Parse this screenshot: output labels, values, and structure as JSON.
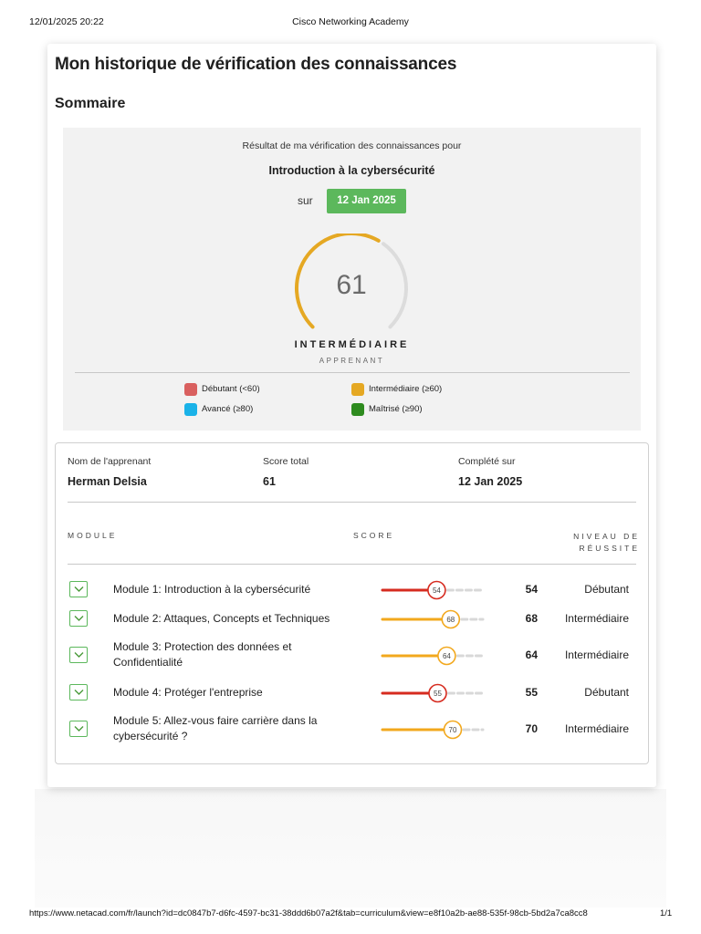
{
  "print_header": {
    "datetime": "12/01/2025 20:22",
    "title": "Cisco Networking Academy"
  },
  "page": {
    "title": "Mon historique de vérification des connaissances",
    "summary_heading": "Sommaire"
  },
  "summary": {
    "intro": "Résultat de ma vérification des connaissances pour",
    "course": "Introduction à la cybersécurité",
    "on_label": "sur",
    "date": "12 Jan 2025",
    "score": "61",
    "score_value": 61,
    "level": "INTERMÉDIAIRE",
    "level_sub": "APPRENANT",
    "legend": [
      {
        "label": "Débutant (<60)",
        "color": "#d9605f"
      },
      {
        "label": "Intermédiaire (≥60)",
        "color": "#e5a823"
      },
      {
        "label": "Avancé (≥80)",
        "color": "#1ab2e8"
      },
      {
        "label": "Maîtrisé (≥90)",
        "color": "#2e8b1f"
      }
    ]
  },
  "learner": {
    "name_label": "Nom de l'apprenant",
    "name": "Herman Delsia",
    "score_label": "Score total",
    "score": "61",
    "completed_label": "Complété sur",
    "completed": "12 Jan 2025"
  },
  "table": {
    "headers": {
      "module": "MODULE",
      "score": "SCORE",
      "level_line1": "NIVEAU DE",
      "level_line2": "RÉUSSITE"
    },
    "rows": [
      {
        "module": "Module 1: Introduction à la cybersécurité",
        "score": "54",
        "value": 54,
        "level": "Débutant",
        "color": "#d62b1f"
      },
      {
        "module": "Module 2: Attaques, Concepts et Techniques",
        "score": "68",
        "value": 68,
        "level": "Intermédiaire",
        "color": "#f2a81d"
      },
      {
        "module": "Module 3: Protection des données et Confidentialité",
        "score": "64",
        "value": 64,
        "level": "Intermédiaire",
        "color": "#f2a81d"
      },
      {
        "module": "Module 4: Protéger l'entreprise",
        "score": "55",
        "value": 55,
        "level": "Débutant",
        "color": "#d62b1f"
      },
      {
        "module": "Module 5: Allez-vous faire carrière dans la cybersécurité ?",
        "score": "70",
        "value": 70,
        "level": "Intermédiaire",
        "color": "#f2a81d"
      }
    ]
  },
  "print_footer": {
    "url": "https://www.netacad.com/fr/launch?id=dc0847b7-d6fc-4597-bc31-38ddd6b07a2f&tab=curriculum&view=e8f10a2b-ae88-535f-98cb-5bd2a7ca8cc8",
    "page": "1/1"
  }
}
